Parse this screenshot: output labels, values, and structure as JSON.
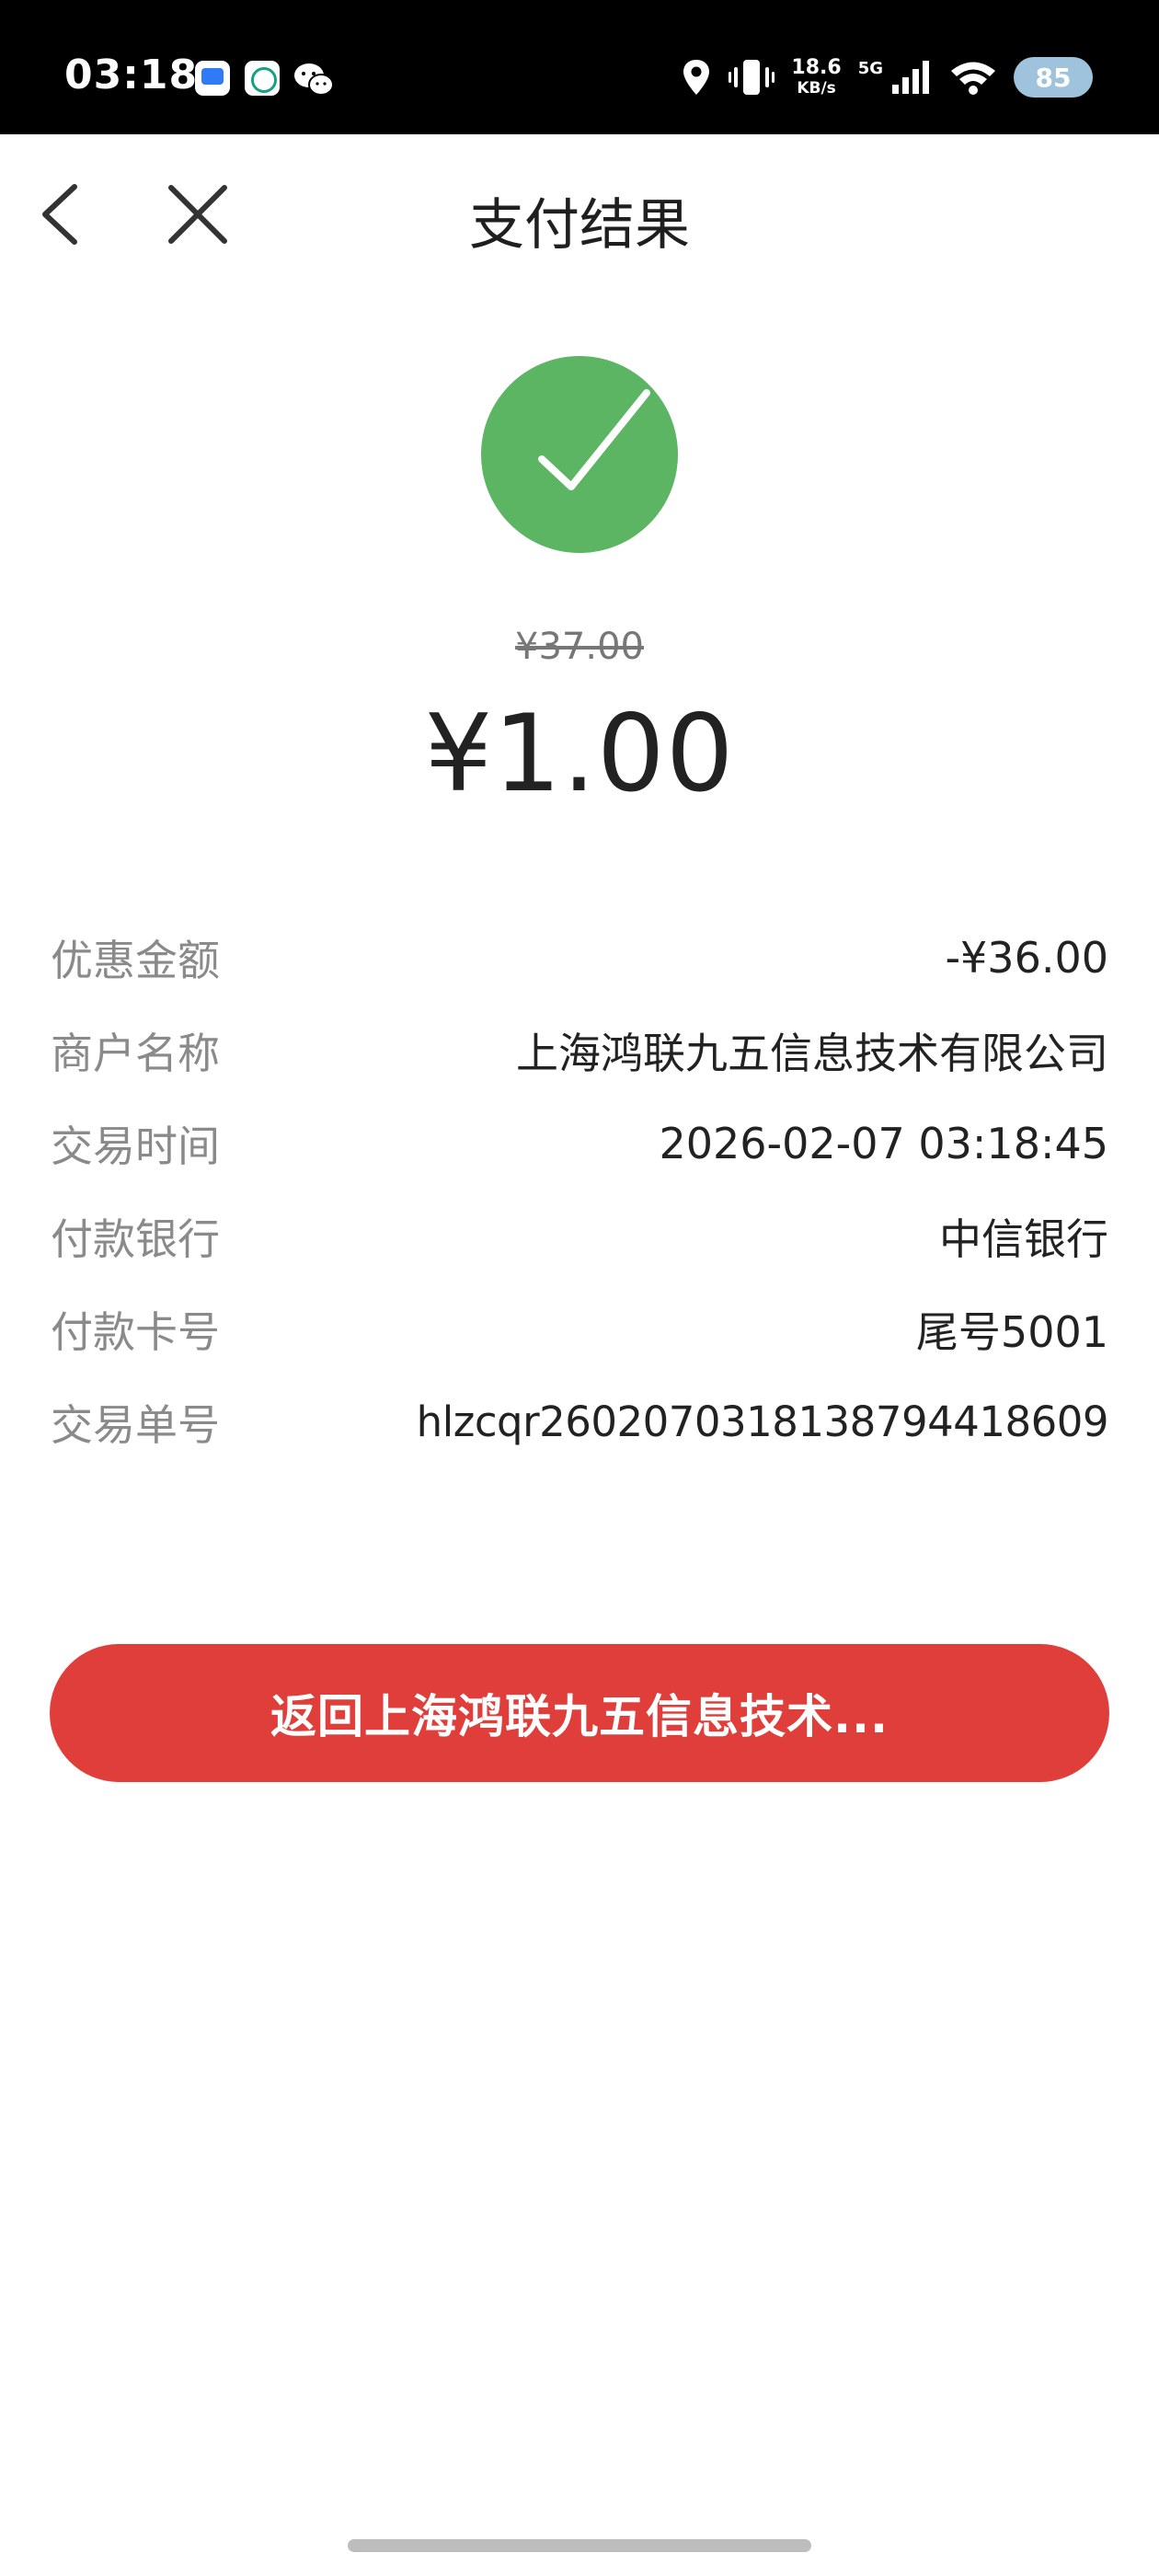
{
  "status_bar": {
    "time": "03:18",
    "net_speed_value": "18.6",
    "net_speed_unit": "KB/s",
    "network_type": "5G",
    "battery": "85",
    "icons": [
      "message-app-icon",
      "bank-app-icon",
      "wechat-icon",
      "location-icon",
      "vibrate-icon",
      "signal-icon",
      "wifi-icon",
      "battery-icon"
    ]
  },
  "header": {
    "title": "支付结果"
  },
  "result": {
    "original_price": "¥37.00",
    "paid_amount": "¥1.00",
    "status_color": "#5bb562"
  },
  "details": [
    {
      "label": "优惠金额",
      "value": "-¥36.00"
    },
    {
      "label": "商户名称",
      "value": "上海鸿联九五信息技术有限公司"
    },
    {
      "label": "交易时间",
      "value": "2026-02-07 03:18:45"
    },
    {
      "label": "付款银行",
      "value": "中信银行"
    },
    {
      "label": "付款卡号",
      "value": "尾号5001"
    },
    {
      "label": "交易单号",
      "value": "hlzcqr26020703181387944186​09"
    }
  ],
  "actions": {
    "return_label": "返回上海鸿联九五信息技术...",
    "button_color": "#e03e3a"
  }
}
